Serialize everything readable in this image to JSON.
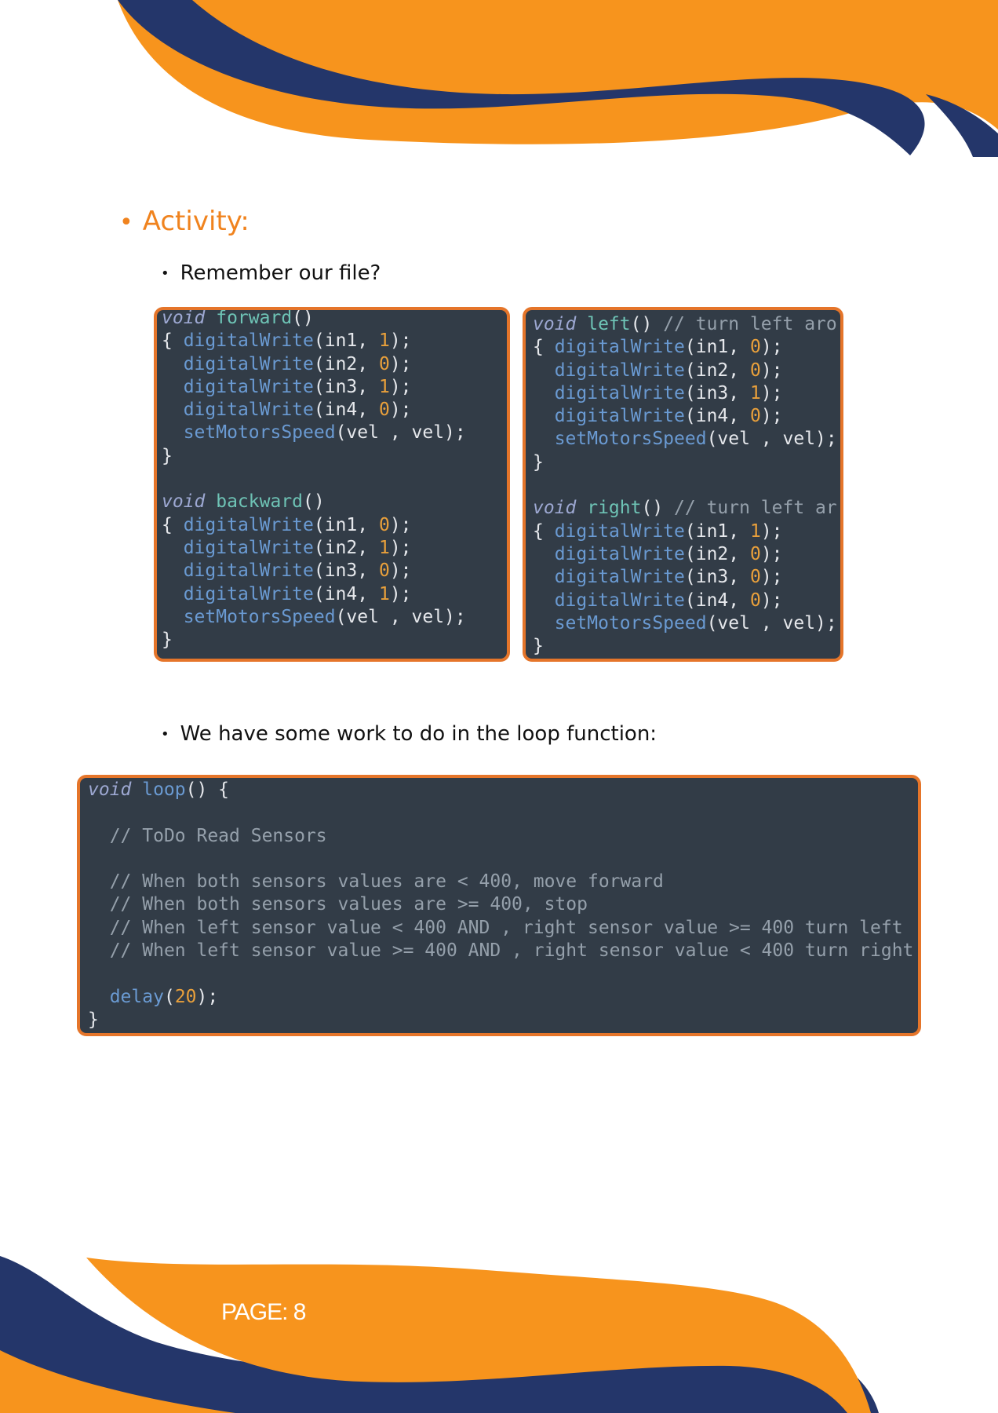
{
  "colors": {
    "orange": "#f7941d",
    "navy": "#24366a",
    "heading": "#f0831e",
    "code_bg": "#323c47",
    "code_border": "#e5752a"
  },
  "heading": {
    "bullet": "•",
    "text": "Activity:"
  },
  "bullets": [
    {
      "bullet": "•",
      "text": "Remember our file?"
    },
    {
      "bullet": "•",
      "text": "We have some work to do in the loop function:"
    }
  ],
  "code_left": [
    [
      {
        "t": "void",
        "c": "kw"
      },
      {
        "t": " forward",
        "c": "fn"
      },
      {
        "t": "()",
        "c": "pn"
      }
    ],
    [
      {
        "t": "{ ",
        "c": "pn"
      },
      {
        "t": "digitalWrite",
        "c": "call"
      },
      {
        "t": "(in1, ",
        "c": "pn"
      },
      {
        "t": "1",
        "c": "num"
      },
      {
        "t": ");",
        "c": "pn"
      }
    ],
    [
      {
        "t": "  ",
        "c": "pn"
      },
      {
        "t": "digitalWrite",
        "c": "call"
      },
      {
        "t": "(in2, ",
        "c": "pn"
      },
      {
        "t": "0",
        "c": "num"
      },
      {
        "t": ");",
        "c": "pn"
      }
    ],
    [
      {
        "t": "  ",
        "c": "pn"
      },
      {
        "t": "digitalWrite",
        "c": "call"
      },
      {
        "t": "(in3, ",
        "c": "pn"
      },
      {
        "t": "1",
        "c": "num"
      },
      {
        "t": ");",
        "c": "pn"
      }
    ],
    [
      {
        "t": "  ",
        "c": "pn"
      },
      {
        "t": "digitalWrite",
        "c": "call"
      },
      {
        "t": "(in4, ",
        "c": "pn"
      },
      {
        "t": "0",
        "c": "num"
      },
      {
        "t": ");",
        "c": "pn"
      }
    ],
    [
      {
        "t": "  ",
        "c": "pn"
      },
      {
        "t": "setMotorsSpeed",
        "c": "call"
      },
      {
        "t": "(vel , vel);",
        "c": "pn"
      }
    ],
    [
      {
        "t": "}",
        "c": "pn"
      }
    ],
    [
      {
        "t": "",
        "c": "pn"
      }
    ],
    [
      {
        "t": "void",
        "c": "kw"
      },
      {
        "t": " backward",
        "c": "fn"
      },
      {
        "t": "()",
        "c": "pn"
      }
    ],
    [
      {
        "t": "{ ",
        "c": "pn"
      },
      {
        "t": "digitalWrite",
        "c": "call"
      },
      {
        "t": "(in1, ",
        "c": "pn"
      },
      {
        "t": "0",
        "c": "num"
      },
      {
        "t": ");",
        "c": "pn"
      }
    ],
    [
      {
        "t": "  ",
        "c": "pn"
      },
      {
        "t": "digitalWrite",
        "c": "call"
      },
      {
        "t": "(in2, ",
        "c": "pn"
      },
      {
        "t": "1",
        "c": "num"
      },
      {
        "t": ");",
        "c": "pn"
      }
    ],
    [
      {
        "t": "  ",
        "c": "pn"
      },
      {
        "t": "digitalWrite",
        "c": "call"
      },
      {
        "t": "(in3, ",
        "c": "pn"
      },
      {
        "t": "0",
        "c": "num"
      },
      {
        "t": ");",
        "c": "pn"
      }
    ],
    [
      {
        "t": "  ",
        "c": "pn"
      },
      {
        "t": "digitalWrite",
        "c": "call"
      },
      {
        "t": "(in4, ",
        "c": "pn"
      },
      {
        "t": "1",
        "c": "num"
      },
      {
        "t": ");",
        "c": "pn"
      }
    ],
    [
      {
        "t": "  ",
        "c": "pn"
      },
      {
        "t": "setMotorsSpeed",
        "c": "call"
      },
      {
        "t": "(vel , vel);",
        "c": "pn"
      }
    ],
    [
      {
        "t": "}",
        "c": "pn"
      }
    ]
  ],
  "code_right": [
    [
      {
        "t": "void",
        "c": "kw"
      },
      {
        "t": " left",
        "c": "fn"
      },
      {
        "t": "() ",
        "c": "pn"
      },
      {
        "t": "// turn left aro",
        "c": "cm"
      }
    ],
    [
      {
        "t": "{ ",
        "c": "pn"
      },
      {
        "t": "digitalWrite",
        "c": "call"
      },
      {
        "t": "(in1, ",
        "c": "pn"
      },
      {
        "t": "0",
        "c": "num"
      },
      {
        "t": ");",
        "c": "pn"
      }
    ],
    [
      {
        "t": "  ",
        "c": "pn"
      },
      {
        "t": "digitalWrite",
        "c": "call"
      },
      {
        "t": "(in2, ",
        "c": "pn"
      },
      {
        "t": "0",
        "c": "num"
      },
      {
        "t": ");",
        "c": "pn"
      }
    ],
    [
      {
        "t": "  ",
        "c": "pn"
      },
      {
        "t": "digitalWrite",
        "c": "call"
      },
      {
        "t": "(in3, ",
        "c": "pn"
      },
      {
        "t": "1",
        "c": "num"
      },
      {
        "t": ");",
        "c": "pn"
      }
    ],
    [
      {
        "t": "  ",
        "c": "pn"
      },
      {
        "t": "digitalWrite",
        "c": "call"
      },
      {
        "t": "(in4, ",
        "c": "pn"
      },
      {
        "t": "0",
        "c": "num"
      },
      {
        "t": ");",
        "c": "pn"
      }
    ],
    [
      {
        "t": "  ",
        "c": "pn"
      },
      {
        "t": "setMotorsSpeed",
        "c": "call"
      },
      {
        "t": "(vel , vel);",
        "c": "pn"
      }
    ],
    [
      {
        "t": "}",
        "c": "pn"
      }
    ],
    [
      {
        "t": "",
        "c": "pn"
      }
    ],
    [
      {
        "t": "void",
        "c": "kw"
      },
      {
        "t": " right",
        "c": "fn"
      },
      {
        "t": "() ",
        "c": "pn"
      },
      {
        "t": "// turn left ar",
        "c": "cm"
      }
    ],
    [
      {
        "t": "{ ",
        "c": "pn"
      },
      {
        "t": "digitalWrite",
        "c": "call"
      },
      {
        "t": "(in1, ",
        "c": "pn"
      },
      {
        "t": "1",
        "c": "num"
      },
      {
        "t": ");",
        "c": "pn"
      }
    ],
    [
      {
        "t": "  ",
        "c": "pn"
      },
      {
        "t": "digitalWrite",
        "c": "call"
      },
      {
        "t": "(in2, ",
        "c": "pn"
      },
      {
        "t": "0",
        "c": "num"
      },
      {
        "t": ");",
        "c": "pn"
      }
    ],
    [
      {
        "t": "  ",
        "c": "pn"
      },
      {
        "t": "digitalWrite",
        "c": "call"
      },
      {
        "t": "(in3, ",
        "c": "pn"
      },
      {
        "t": "0",
        "c": "num"
      },
      {
        "t": ");",
        "c": "pn"
      }
    ],
    [
      {
        "t": "  ",
        "c": "pn"
      },
      {
        "t": "digitalWrite",
        "c": "call"
      },
      {
        "t": "(in4, ",
        "c": "pn"
      },
      {
        "t": "0",
        "c": "num"
      },
      {
        "t": ");",
        "c": "pn"
      }
    ],
    [
      {
        "t": "  ",
        "c": "pn"
      },
      {
        "t": "setMotorsSpeed",
        "c": "call"
      },
      {
        "t": "(vel , vel);",
        "c": "pn"
      }
    ],
    [
      {
        "t": "}",
        "c": "pn"
      }
    ]
  ],
  "code_loop": [
    [
      {
        "t": "void",
        "c": "kw"
      },
      {
        "t": " loop",
        "c": "call"
      },
      {
        "t": "() {",
        "c": "pn"
      }
    ],
    [
      {
        "t": "",
        "c": "pn"
      }
    ],
    [
      {
        "t": "  ",
        "c": "pn"
      },
      {
        "t": "// ToDo Read Sensors",
        "c": "cm"
      }
    ],
    [
      {
        "t": "",
        "c": "pn"
      }
    ],
    [
      {
        "t": "  ",
        "c": "pn"
      },
      {
        "t": "// When both sensors values are < 400, move forward",
        "c": "cm"
      }
    ],
    [
      {
        "t": "  ",
        "c": "pn"
      },
      {
        "t": "// When both sensors values are >= 400, stop",
        "c": "cm"
      }
    ],
    [
      {
        "t": "  ",
        "c": "pn"
      },
      {
        "t": "// When left sensor value < 400 AND , right sensor value >= 400 turn left",
        "c": "cm"
      }
    ],
    [
      {
        "t": "  ",
        "c": "pn"
      },
      {
        "t": "// When left sensor value >= 400 AND , right sensor value < 400 turn right",
        "c": "cm"
      }
    ],
    [
      {
        "t": "",
        "c": "pn"
      }
    ],
    [
      {
        "t": "  ",
        "c": "pn"
      },
      {
        "t": "delay",
        "c": "call"
      },
      {
        "t": "(",
        "c": "pn"
      },
      {
        "t": "20",
        "c": "num"
      },
      {
        "t": ");",
        "c": "pn"
      }
    ],
    [
      {
        "t": "}",
        "c": "pn"
      }
    ]
  ],
  "footer": {
    "page_label": "PAGE: 8"
  }
}
